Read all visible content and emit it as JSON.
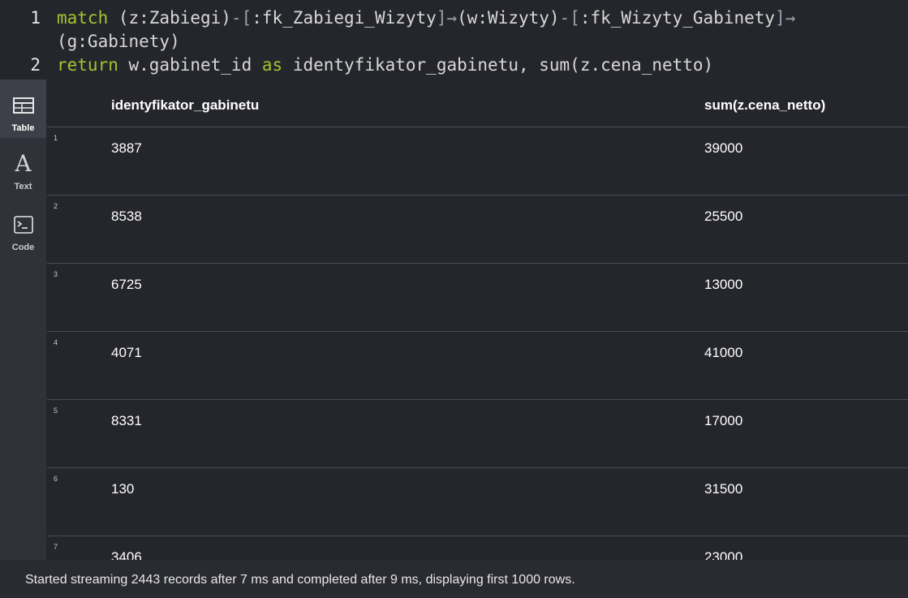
{
  "editor": {
    "lines": [
      {
        "number": "1",
        "tokens": [
          {
            "t": "match",
            "c": "kw"
          },
          {
            "t": " (z:Zabiegi)",
            "c": "txt"
          },
          {
            "t": "-[",
            "c": "pt"
          },
          {
            "t": ":fk_Zabiegi_Wizyty",
            "c": "txt"
          },
          {
            "t": "]→",
            "c": "pt"
          },
          {
            "t": "(w:Wizyty)",
            "c": "txt"
          },
          {
            "t": "-[",
            "c": "pt"
          },
          {
            "t": ":fk_Wizyty_Gabinety",
            "c": "txt"
          },
          {
            "t": "]→",
            "c": "pt"
          }
        ]
      },
      {
        "number": "",
        "tokens": [
          {
            "t": "(g:Gabinety)",
            "c": "txt"
          }
        ]
      },
      {
        "number": "2",
        "tokens": [
          {
            "t": "return",
            "c": "kw"
          },
          {
            "t": " w.gabinet_id ",
            "c": "txt"
          },
          {
            "t": "as",
            "c": "kw"
          },
          {
            "t": " identyfikator_gabinetu, sum(z.cena_netto)",
            "c": "txt"
          }
        ]
      }
    ]
  },
  "sidebar": {
    "items": [
      {
        "label": "Table",
        "icon": "table-icon",
        "active": true
      },
      {
        "label": "Text",
        "icon": "text-icon",
        "active": false
      },
      {
        "label": "Code",
        "icon": "code-icon",
        "active": false
      }
    ]
  },
  "table": {
    "columns": [
      "identyfikator_gabinetu",
      "sum(z.cena_netto)"
    ],
    "rows": [
      {
        "n": "1",
        "c1": "3887",
        "c2": "39000"
      },
      {
        "n": "2",
        "c1": "8538",
        "c2": "25500"
      },
      {
        "n": "3",
        "c1": "6725",
        "c2": "13000"
      },
      {
        "n": "4",
        "c1": "4071",
        "c2": "41000"
      },
      {
        "n": "5",
        "c1": "8331",
        "c2": "17000"
      },
      {
        "n": "6",
        "c1": "130",
        "c2": "31500"
      },
      {
        "n": "7",
        "c1": "3406",
        "c2": "23000"
      }
    ]
  },
  "footer": {
    "status": "Started streaming 2443 records after 7 ms and completed after 9 ms, displaying first 1000 rows."
  },
  "colors": {
    "background": "#25262c",
    "keyword": "#a6c22e",
    "sidebar": "#303239",
    "sidebar_active": "#3d4048"
  }
}
